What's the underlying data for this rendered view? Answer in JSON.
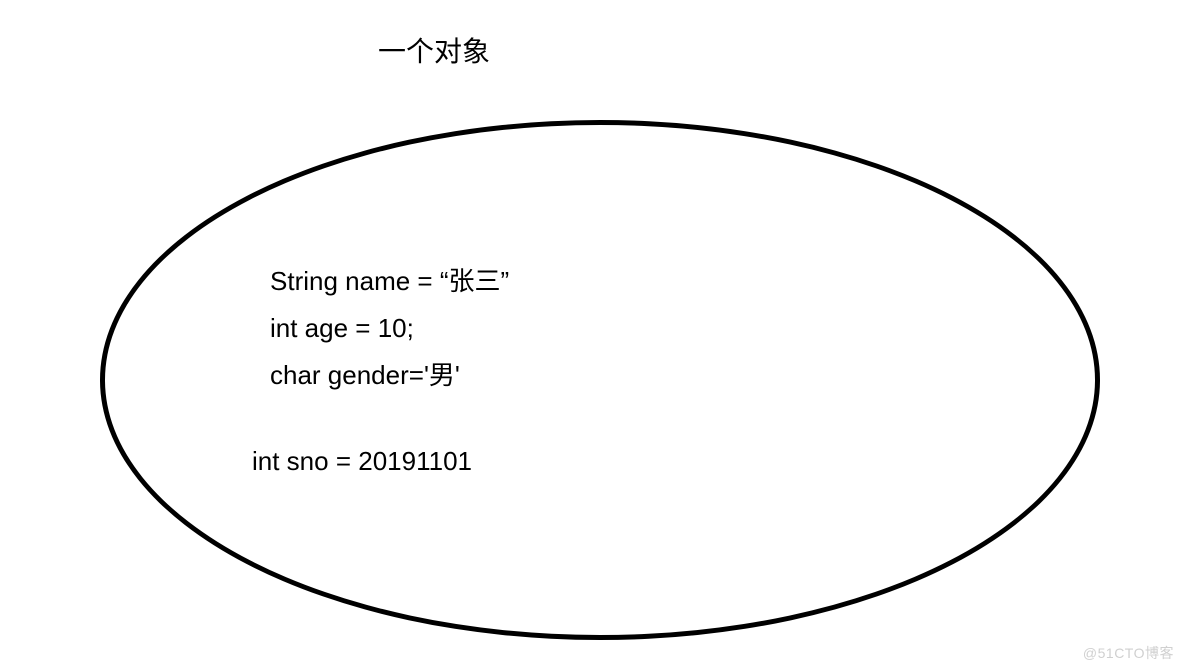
{
  "diagram": {
    "title": "一个对象",
    "code_lines": {
      "line1": "String name = “张三”",
      "line2": "int age = 10;",
      "line3": "char gender='男'",
      "line4": "int sno = 20191101"
    }
  },
  "watermark": "@51CTO博客"
}
